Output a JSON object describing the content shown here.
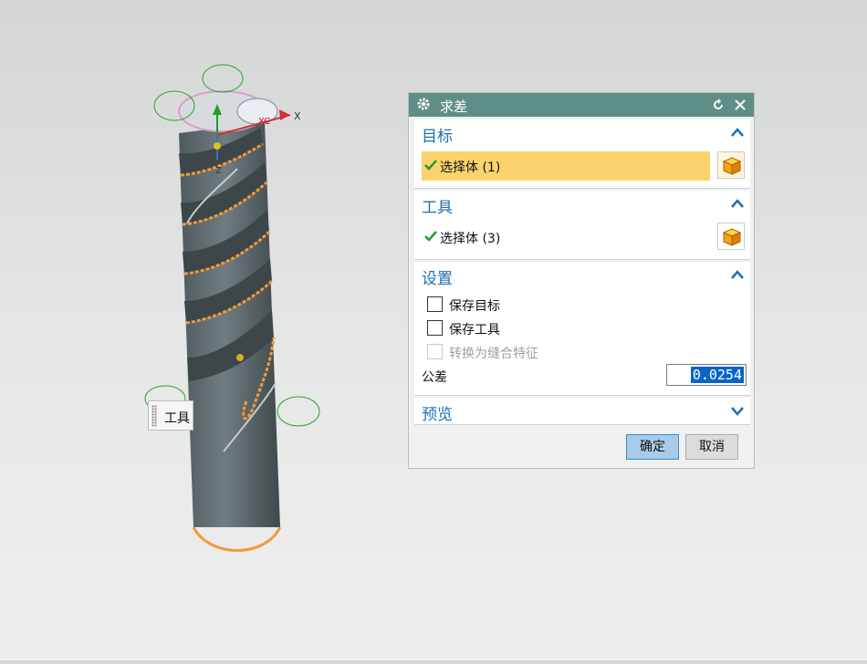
{
  "dialog": {
    "title": "求差",
    "groups": {
      "target": {
        "header": "目标",
        "selection_label": "选择体 (1)"
      },
      "tool": {
        "header": "工具",
        "selection_label": "选择体 (3)"
      },
      "settings": {
        "header": "设置",
        "keep_target": "保存目标",
        "keep_tool": "保存工具",
        "convert_to_stitch": "转换为缝合特征",
        "tolerance_label": "公差",
        "tolerance_value": "0.0254"
      },
      "preview": {
        "header": "预览"
      }
    },
    "buttons": {
      "ok": "确定",
      "cancel": "取消"
    }
  },
  "viewport": {
    "axis_label": "X",
    "axis_label_xc": "XC",
    "axis_label_z": "Z",
    "tooltip_label": "工具"
  },
  "colors": {
    "title_bar": "#5e8f87",
    "header_text": "#1d6fb3",
    "active_selection": "#fbd36c",
    "ok_button": "#a7cbe8",
    "body_color": "#5f6b70",
    "edge_highlight": "#f29a3b"
  }
}
